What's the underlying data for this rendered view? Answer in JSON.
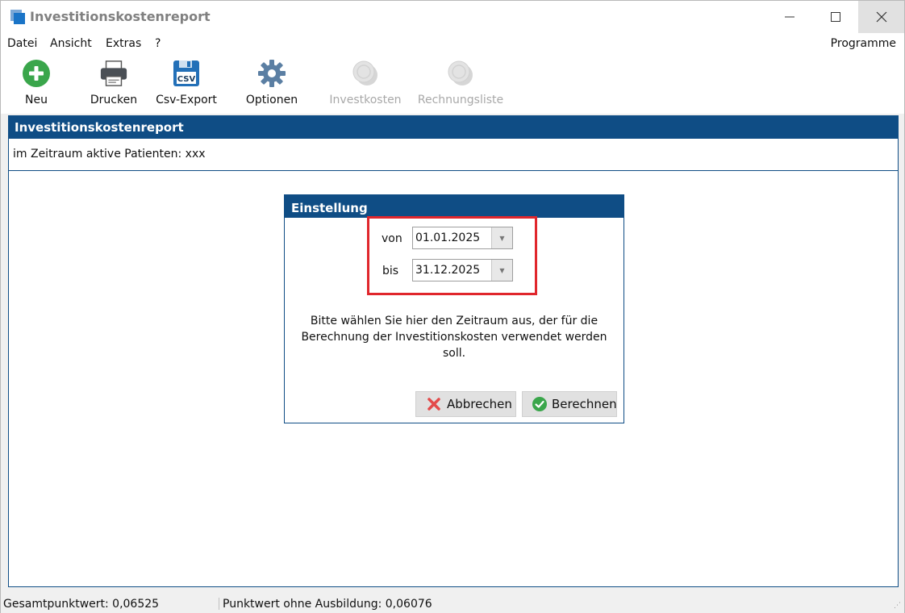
{
  "window": {
    "title": "Investitionskostenreport",
    "controls": {
      "minimize": "—",
      "maximize": "☐",
      "close": "✕"
    }
  },
  "menu": {
    "items": [
      "Datei",
      "Ansicht",
      "Extras",
      "?"
    ],
    "right": "Programme"
  },
  "toolbar": {
    "items": [
      {
        "label": "Neu",
        "icon": "plus-circle-icon",
        "enabled": true
      },
      {
        "label": "Drucken",
        "icon": "printer-icon",
        "enabled": true
      },
      {
        "label": "Csv-Export",
        "icon": "csv-floppy-icon",
        "enabled": true
      },
      {
        "label": "Optionen",
        "icon": "gear-icon",
        "enabled": true
      },
      {
        "label": "Investkosten",
        "icon": "coins-icon",
        "enabled": false
      },
      {
        "label": "Rechnungsliste",
        "icon": "coins-icon",
        "enabled": false
      }
    ]
  },
  "report": {
    "header": "Investitionskostenreport",
    "info": "im Zeitraum aktive Patienten: xxx"
  },
  "dialog": {
    "title": "Einstellung",
    "from_label": "von",
    "from_value": "01.01.2025",
    "to_label": "bis",
    "to_value": "31.12.2025",
    "message_lines": [
      "Bitte wählen Sie hier den Zeitraum aus, der für die",
      "Berechnung der Investitionskosten verwendet werden",
      "soll."
    ],
    "cancel_label": "Abbrechen",
    "ok_label": "Berechnen"
  },
  "status": {
    "left": "Gesamtpunktwert: 0,06525",
    "right": "Punktwert ohne Ausbildung: 0,06076"
  },
  "colors": {
    "accent": "#0f4d85",
    "highlight": "#e0262c",
    "disabled_text": "#a8a8a8",
    "ok_green": "#3aa64b",
    "cancel_red": "#e34a4a"
  }
}
